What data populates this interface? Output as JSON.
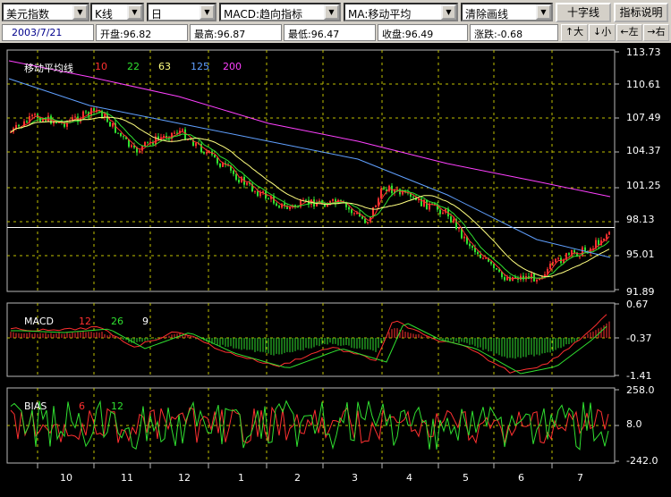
{
  "toolbar": {
    "symbol_select": "美元指数",
    "chart_type_select": "K线",
    "period_select": "日",
    "indicator_select": "MACD:趋向指标",
    "overlay_select": "MA:移动平均",
    "draw_select": "清除画线",
    "crosshair_button": "十字线",
    "help_button": "指标说明"
  },
  "quote": {
    "date": "2003/7/21",
    "open": "开盘:96.82",
    "high": "最高:96.87",
    "low": "最低:96.47",
    "close": "收盘:96.49",
    "change": "涨跌:-0.68"
  },
  "nav": {
    "bigger": "↑大",
    "smaller": "↓小",
    "left": "←左",
    "right": "→右"
  },
  "ma_panel": {
    "title": "移动平均线",
    "params": [
      "10",
      "22",
      "63",
      "125",
      "200"
    ],
    "y_ticks": [
      "113.73",
      "110.61",
      "107.49",
      "104.37",
      "101.25",
      "98.13",
      "95.01",
      "91.89"
    ],
    "price_line": 97.6
  },
  "macd_panel": {
    "title": "MACD",
    "params": [
      "12",
      "26",
      "9"
    ],
    "y_ticks": [
      "0.67",
      "-0.37",
      "-1.41"
    ]
  },
  "bias_panel": {
    "title": "BIAS",
    "params": [
      "6",
      "12"
    ],
    "y_ticks": [
      "258.0",
      "8.0",
      "-242.0"
    ]
  },
  "x_months": [
    "10",
    "11",
    "12",
    "1",
    "2",
    "3",
    "4",
    "5",
    "6",
    "7"
  ],
  "colors": {
    "background": "#000000",
    "up_candle": "#ff3030",
    "down_candle": "#30e030",
    "ma10": "#ff3030",
    "ma22": "#30e030",
    "ma63": "#ffff80",
    "ma125": "#60a0ff",
    "ma200": "#ff40ff",
    "grid": "#c0c000",
    "border": "#b8b8b8"
  }
}
